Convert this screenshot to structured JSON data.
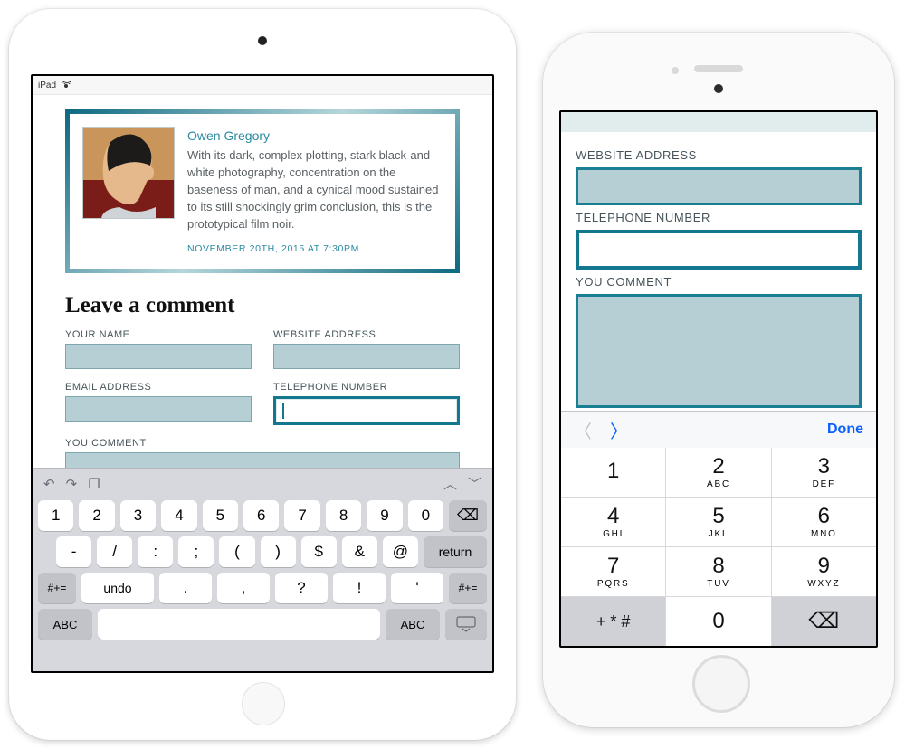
{
  "ipad": {
    "status_label": "iPad",
    "comment_card": {
      "author": "Owen Gregory",
      "body": "With its dark, complex plotting, stark black-and-white photography, concentration on the baseness of man, and a cynical mood sustained to its still shockingly grim conclusion, this is the prototypical film noir.",
      "timestamp": "NOVEMBER 20TH, 2015 AT 7:30PM"
    },
    "form_heading": "Leave a comment",
    "labels": {
      "name": "YOUR NAME",
      "website": "WEBSITE ADDRESS",
      "email": "EMAIL ADDRESS",
      "phone": "TELEPHONE NUMBER",
      "comment": "YOU COMMENT"
    },
    "keyboard": {
      "row1": [
        "1",
        "2",
        "3",
        "4",
        "5",
        "6",
        "7",
        "8",
        "9",
        "0"
      ],
      "row2": [
        "-",
        "/",
        ":",
        ";",
        "(",
        ")",
        "$",
        "&",
        "@"
      ],
      "return": "return",
      "mod": "#+=",
      "undo": "undo",
      "punct": [
        ".",
        ",",
        "?",
        "!",
        "'"
      ],
      "abc": "ABC"
    }
  },
  "iphone": {
    "labels": {
      "website": "WEBSITE ADDRESS",
      "phone": "TELEPHONE NUMBER",
      "comment": "YOU COMMENT"
    },
    "accessory": {
      "done": "Done"
    },
    "numpad": {
      "keys": [
        {
          "d": "1",
          "l": ""
        },
        {
          "d": "2",
          "l": "ABC"
        },
        {
          "d": "3",
          "l": "DEF"
        },
        {
          "d": "4",
          "l": "GHI"
        },
        {
          "d": "5",
          "l": "JKL"
        },
        {
          "d": "6",
          "l": "MNO"
        },
        {
          "d": "7",
          "l": "PQRS"
        },
        {
          "d": "8",
          "l": "TUV"
        },
        {
          "d": "9",
          "l": "WXYZ"
        }
      ],
      "sym": "+ * #",
      "zero": "0"
    }
  }
}
